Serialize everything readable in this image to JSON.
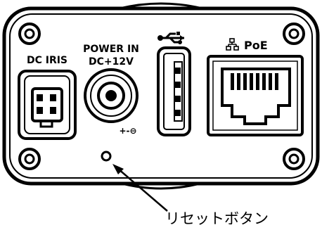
{
  "panel": {
    "dc_iris_label": "DC IRIS",
    "power_in_label": "POWER IN",
    "power_voltage_label": "DC+12V",
    "polarity_symbol": "+-⊖",
    "poe_label": "PoE"
  },
  "callout": {
    "reset_button_label": "リセットボタン"
  },
  "colors": {
    "line": "#000000",
    "background": "#ffffff"
  }
}
